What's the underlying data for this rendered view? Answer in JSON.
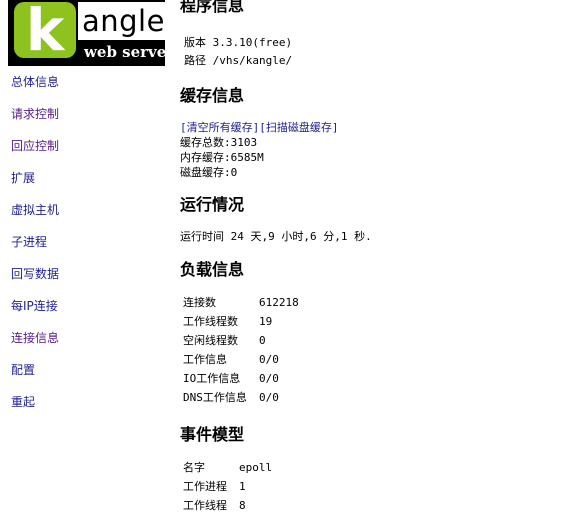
{
  "logo": {
    "k": "k",
    "word": "angle",
    "tagline": "web server",
    "colors": {
      "k_bg": "#8dc21f",
      "bg": "#000000"
    }
  },
  "nav": [
    {
      "id": "overview",
      "label": "总体信息"
    },
    {
      "id": "request",
      "label": "请求控制"
    },
    {
      "id": "response",
      "label": "回应控制"
    },
    {
      "id": "extend",
      "label": "扩展"
    },
    {
      "id": "vhost",
      "label": "虚拟主机"
    },
    {
      "id": "process",
      "label": "子进程"
    },
    {
      "id": "writeback",
      "label": "回写数据"
    },
    {
      "id": "perip",
      "label": "每IP连接"
    },
    {
      "id": "connections",
      "label": "连接信息"
    },
    {
      "id": "config",
      "label": "配置"
    },
    {
      "id": "restart",
      "label": "重起"
    }
  ],
  "program": {
    "title": "程序信息",
    "version": "版本 3.3.10(free)",
    "path": "路径 /vhs/kangle/"
  },
  "cache": {
    "title": "缓存信息",
    "clear_all": "[清空所有缓存]",
    "scan_disk": "[扫描磁盘缓存]",
    "total": "缓存总数:3103",
    "memory": "内存缓存:6585M",
    "disk": "磁盘缓存:0"
  },
  "runtime": {
    "title": "运行情况",
    "uptime": "运行时间 24 天,9 小时,6 分,1 秒."
  },
  "load": {
    "title": "负载信息",
    "rows": [
      {
        "label": "连接数",
        "value": "612218"
      },
      {
        "label": "工作线程数",
        "value": "19"
      },
      {
        "label": "空闲线程数",
        "value": "0"
      },
      {
        "label": "工作信息",
        "value": "0/0"
      },
      {
        "label": "IO工作信息",
        "value": "0/0"
      },
      {
        "label": "DNS工作信息",
        "value": "0/0"
      }
    ]
  },
  "event": {
    "title": "事件模型",
    "rows": [
      {
        "label": "名字",
        "value": "epoll"
      },
      {
        "label": "工作进程",
        "value": "1"
      },
      {
        "label": "工作线程",
        "value": "8"
      }
    ]
  }
}
